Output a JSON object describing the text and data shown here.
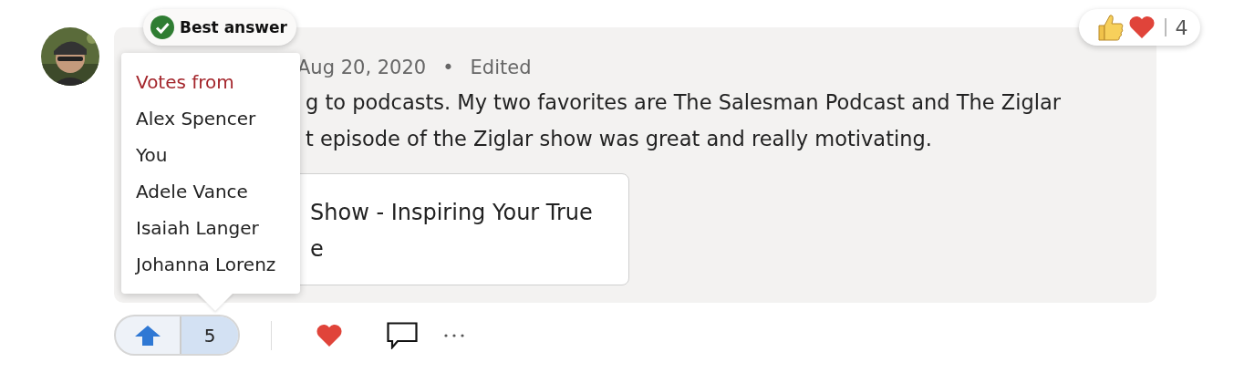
{
  "badge": {
    "label": "Best answer"
  },
  "reactions": {
    "count": "4"
  },
  "post": {
    "meta": {
      "date": "Aug 20, 2020",
      "separator": "•",
      "status": "Edited"
    },
    "lines": [
      "g to podcasts. My two favorites are The Salesman Podcast and The Ziglar",
      "t episode of the Ziglar show was great and really motivating."
    ],
    "link_card": {
      "lines": [
        "Show - Inspiring Your True",
        "e"
      ]
    }
  },
  "votes_popup": {
    "title": "Votes from",
    "voters": [
      "Alex Spencer",
      "You",
      "Adele Vance",
      "Isaiah Langer",
      "Johanna Lorenz"
    ]
  },
  "actions": {
    "vote_count": "5"
  }
}
